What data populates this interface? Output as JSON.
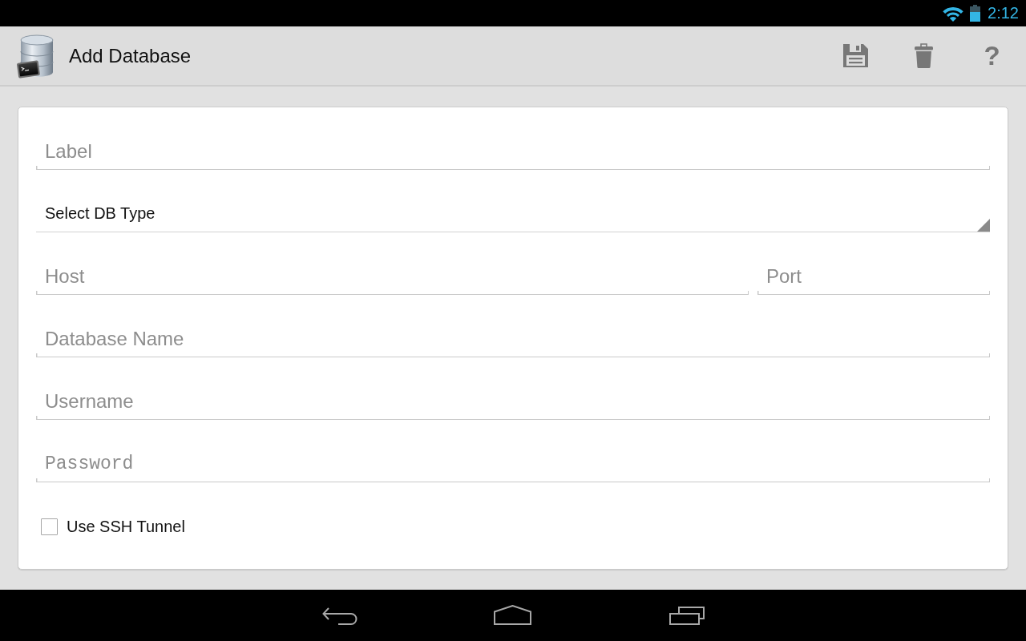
{
  "status_bar": {
    "time": "2:12"
  },
  "action_bar": {
    "title": "Add Database",
    "help": "?"
  },
  "form": {
    "fields": [
      {
        "kind": "text",
        "placeholder": "Label"
      },
      {
        "kind": "select",
        "value": "Select DB Type"
      },
      {
        "kind": "pair",
        "fields": [
          {
            "kind": "text",
            "placeholder": "Host"
          },
          {
            "kind": "text",
            "placeholder": "Port"
          }
        ]
      },
      {
        "kind": "text",
        "placeholder": "Database Name"
      },
      {
        "kind": "text",
        "placeholder": "Username"
      },
      {
        "kind": "password",
        "placeholder": "Password"
      }
    ],
    "checkbox": {
      "label": "Use SSH Tunnel",
      "checked": false
    }
  }
}
